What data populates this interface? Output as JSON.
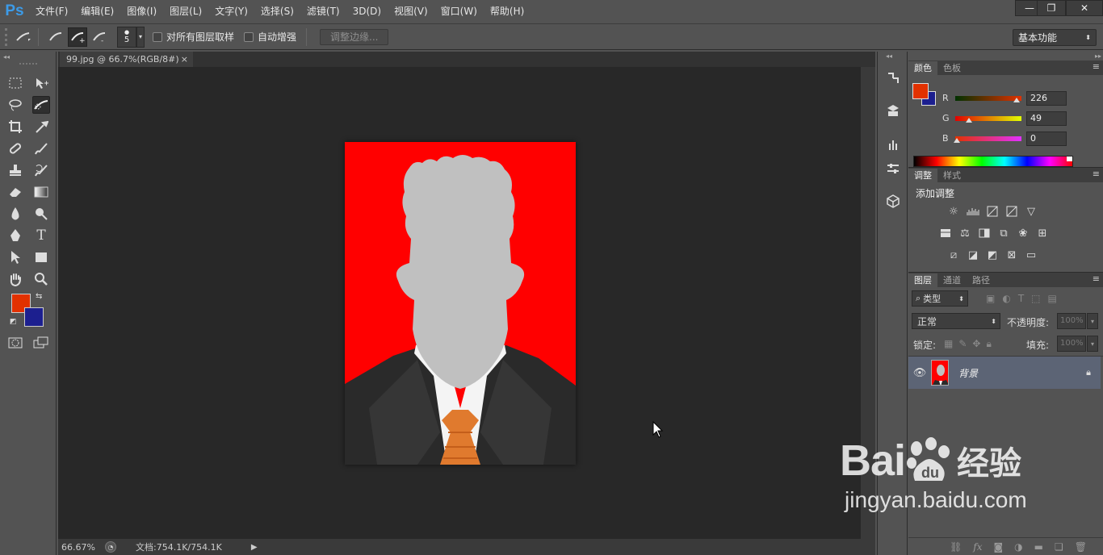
{
  "app": {
    "logo": "Ps"
  },
  "menubar": {
    "items": [
      "文件(F)",
      "编辑(E)",
      "图像(I)",
      "图层(L)",
      "文字(Y)",
      "选择(S)",
      "滤镜(T)",
      "3D(D)",
      "视图(V)",
      "窗口(W)",
      "帮助(H)"
    ]
  },
  "window_controls": {
    "minimize": "—",
    "restore": "❐",
    "close": "✕"
  },
  "options": {
    "brush_size": "5",
    "sample_all_layers": "对所有图层取样",
    "auto_enhance": "自动增强",
    "refine_edge": "调整边缘...",
    "workspace": "基本功能"
  },
  "document": {
    "tab_title": "99.jpg @ 66.7%(RGB/8#)",
    "close": "×"
  },
  "status": {
    "zoom": "66.67%",
    "doc_size": "文档:754.1K/754.1K"
  },
  "colors": {
    "foreground": "#e23100",
    "background": "#1c1f8f"
  },
  "color_panel": {
    "tabs": [
      "颜色",
      "色板"
    ],
    "r_label": "R",
    "g_label": "G",
    "b_label": "B",
    "r": "226",
    "g": "49",
    "b": "0"
  },
  "adjustments_panel": {
    "tabs": [
      "调整",
      "样式"
    ],
    "heading": "添加调整"
  },
  "layers_panel": {
    "tabs": [
      "图层",
      "通道",
      "路径"
    ],
    "filter_kind": "类型",
    "blend_mode": "正常",
    "opacity_label": "不透明度:",
    "opacity": "100%",
    "lock_label": "锁定:",
    "fill_label": "填充:",
    "fill": "100%",
    "layers": [
      {
        "name": "背景",
        "visible": true,
        "locked": true
      }
    ]
  },
  "watermark": {
    "brand": "Bai",
    "brand2": "经验",
    "url": "jingyan.baidu.com"
  }
}
